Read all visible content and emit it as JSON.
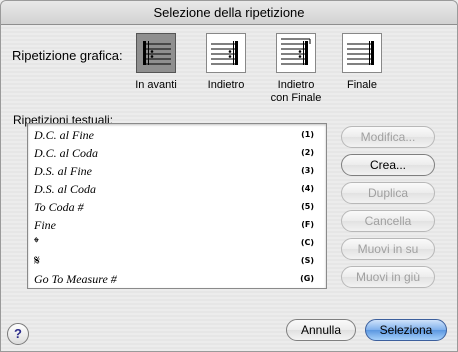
{
  "window": {
    "title": "Selezione della ripetizione"
  },
  "graphic": {
    "label": "Ripetizione grafica:",
    "options": [
      {
        "caption": "In avanti",
        "icon": "repeat-forward-icon",
        "selected": true
      },
      {
        "caption": "Indietro",
        "icon": "repeat-backward-icon",
        "selected": false
      },
      {
        "caption": "Indietro\ncon Finale",
        "icon": "repeat-backward-final-icon",
        "selected": false
      },
      {
        "caption": "Finale",
        "icon": "final-barline-icon",
        "selected": false
      }
    ]
  },
  "text_repeats": {
    "label": "Ripetizioni testuali:",
    "items": [
      {
        "text": "D.C. al Fine",
        "key": "(1)"
      },
      {
        "text": "D.C. al Coda",
        "key": "(2)"
      },
      {
        "text": "D.S. al Fine",
        "key": "(3)"
      },
      {
        "text": "D.S. al Coda",
        "key": "(4)"
      },
      {
        "text": "To Coda #",
        "key": "(5)"
      },
      {
        "text": "Fine",
        "key": "(F)"
      },
      {
        "text": "𝄌",
        "key": "(C)",
        "symbol": "coda-icon"
      },
      {
        "text": "𝄋",
        "key": "(S)",
        "symbol": "segno-icon"
      },
      {
        "text": "Go To Measure #",
        "key": "(G)"
      }
    ]
  },
  "buttons": {
    "edit": "Modifica...",
    "create": "Crea...",
    "duplicate": "Duplica",
    "delete": "Cancella",
    "move_up": "Muovi in su",
    "move_down": "Muovi in giù",
    "cancel": "Annulla",
    "ok": "Seleziona",
    "help": "?"
  }
}
